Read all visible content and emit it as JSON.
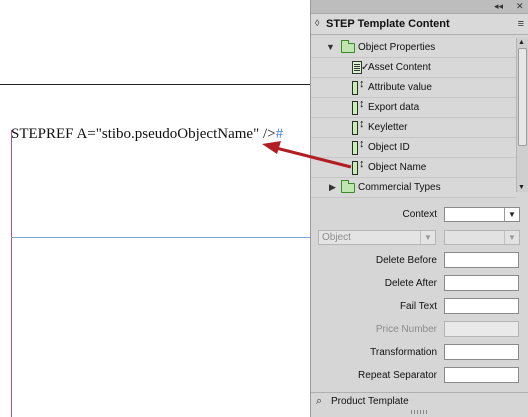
{
  "document": {
    "code_text": "STEPREF A=\"stibo.pseudoObjectName\" />",
    "code_hash": "#"
  },
  "panel": {
    "title": "STEP Template Content",
    "collapse_glyph": "◂◂",
    "close_glyph": "✕",
    "menu_glyph": "≡",
    "tree": [
      {
        "label": "Object Properties",
        "icon": "folder-icon",
        "expanded": true
      },
      {
        "label": "Asset Content",
        "icon": "asset-content-icon"
      },
      {
        "label": "Attribute value",
        "icon": "field-icon"
      },
      {
        "label": "Export data",
        "icon": "field-icon"
      },
      {
        "label": "Keyletter",
        "icon": "field-icon"
      },
      {
        "label": "Object ID",
        "icon": "field-icon"
      },
      {
        "label": "Object Name",
        "icon": "field-icon"
      },
      {
        "label": "Commercial Types",
        "icon": "folder-icon",
        "expanded": false
      }
    ],
    "form": {
      "context_label": "Context",
      "context_value": "",
      "object_select_value": "Object",
      "delete_before_label": "Delete Before",
      "delete_after_label": "Delete After",
      "fail_text_label": "Fail Text",
      "price_number_label": "Price Number",
      "transformation_label": "Transformation",
      "repeat_separator_label": "Repeat Separator"
    },
    "bottom_label": "Product Template"
  },
  "colors": {
    "arrow": "#b11f24",
    "frame": "#c04a9a",
    "guide": "#79a6d6",
    "folder_fill": "#bfe6b0"
  }
}
